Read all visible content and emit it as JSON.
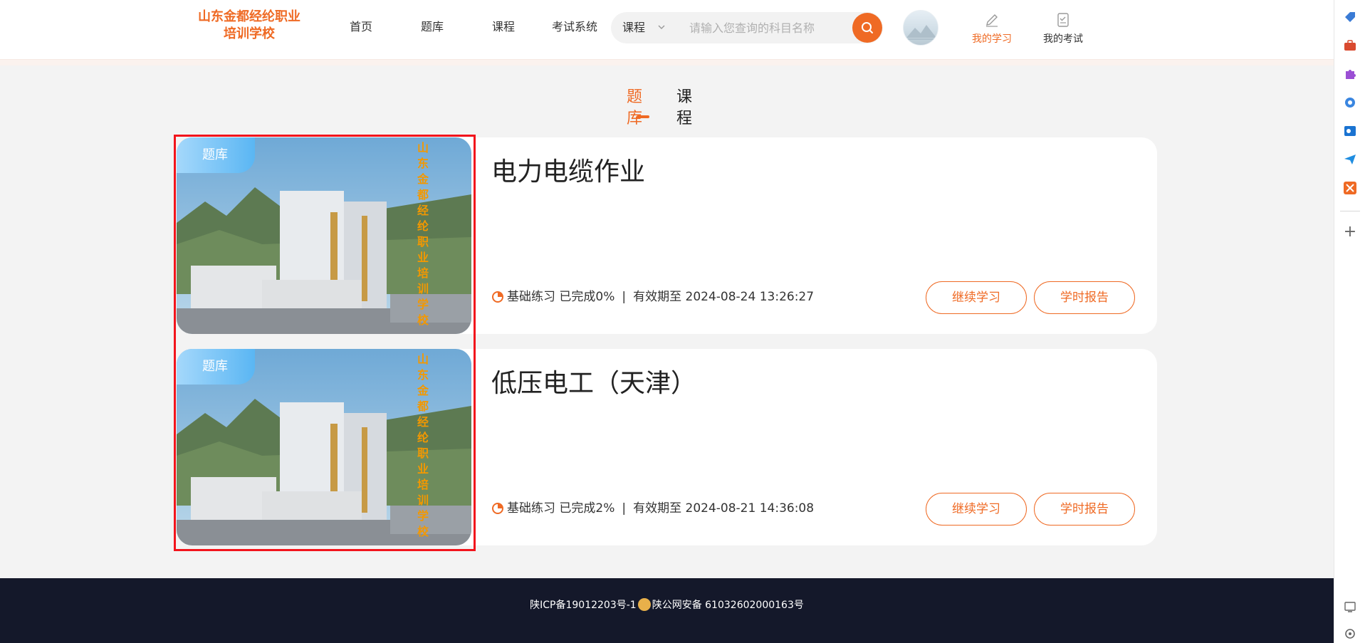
{
  "header": {
    "logo_line1": "山东金都经纶职业",
    "logo_line2": "培训学校",
    "nav": [
      "首页",
      "题库",
      "课程",
      "考试系统"
    ],
    "search": {
      "select_value": "课程",
      "placeholder": "请输入您查询的科目名称"
    },
    "my_study": "我的学习",
    "my_exam": "我的考试"
  },
  "tabs": [
    {
      "label": "题库",
      "active": true
    },
    {
      "label": "课程",
      "active": false
    }
  ],
  "cards": [
    {
      "badge": "题库",
      "watermark": "山东金都经纶职业培训学校",
      "title": "电力电缆作业",
      "progress_text": "基础练习 已完成0%",
      "separator": "|",
      "expiry": "有效期至 2024-08-24 13:26:27",
      "btn_continue": "继续学习",
      "btn_report": "学时报告"
    },
    {
      "badge": "题库",
      "watermark": "山东金都经纶职业培训学校",
      "title": "低压电工（天津）",
      "progress_text": "基础练习 已完成2%",
      "separator": "|",
      "expiry": "有效期至 2024-08-21 14:36:08",
      "btn_continue": "继续学习",
      "btn_report": "学时报告"
    }
  ],
  "footer": {
    "icp": "陕ICP备19012203号-1",
    "police": "陕公网安备 61032602000163号"
  },
  "colors": {
    "accent": "#ef6a24",
    "badge": "#5ab6f3",
    "footer_bg": "#14182a",
    "highlight": "#f2141c"
  }
}
